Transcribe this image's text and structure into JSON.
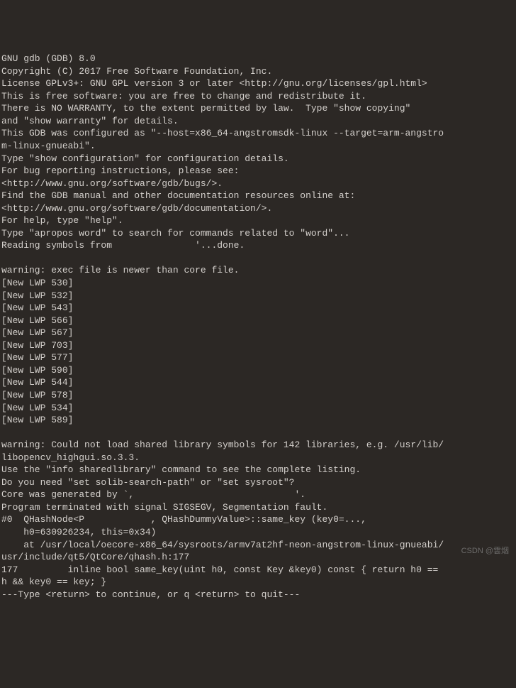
{
  "terminal": {
    "lines": [
      "GNU gdb (GDB) 8.0",
      "Copyright (C) 2017 Free Software Foundation, Inc.",
      "License GPLv3+: GNU GPL version 3 or later <http://gnu.org/licenses/gpl.html>",
      "This is free software: you are free to change and redistribute it.",
      "There is NO WARRANTY, to the extent permitted by law.  Type \"show copying\"",
      "and \"show warranty\" for details.",
      "This GDB was configured as \"--host=x86_64-angstromsdk-linux --target=arm-angstro",
      "m-linux-gnueabi\".",
      "Type \"show configuration\" for configuration details.",
      "For bug reporting instructions, please see:",
      "<http://www.gnu.org/software/gdb/bugs/>.",
      "Find the GDB manual and other documentation resources online at:",
      "<http://www.gnu.org/software/gdb/documentation/>.",
      "For help, type \"help\".",
      "Type \"apropos word\" to search for commands related to \"word\"...",
      "Reading symbols from               '...done.",
      "",
      "warning: exec file is newer than core file.",
      "[New LWP 530]",
      "[New LWP 532]",
      "[New LWP 543]",
      "[New LWP 566]",
      "[New LWP 567]",
      "[New LWP 703]",
      "[New LWP 577]",
      "[New LWP 590]",
      "[New LWP 544]",
      "[New LWP 578]",
      "[New LWP 534]",
      "[New LWP 589]",
      "",
      "warning: Could not load shared library symbols for 142 libraries, e.g. /usr/lib/",
      "libopencv_highgui.so.3.3.",
      "Use the \"info sharedlibrary\" command to see the complete listing.",
      "Do you need \"set solib-search-path\" or \"set sysroot\"?",
      "Core was generated by `,                             '.",
      "Program terminated with signal SIGSEGV, Segmentation fault.",
      "#0  QHashNode<P            , QHashDummyValue>::same_key (key0=...,",
      "    h0=630926234, this=0x34)",
      "    at /usr/local/oecore-x86_64/sysroots/armv7at2hf-neon-angstrom-linux-gnueabi/",
      "usr/include/qt5/QtCore/qhash.h:177",
      "177         inline bool same_key(uint h0, const Key &key0) const { return h0 ==",
      "h && key0 == key; }",
      "---Type <return> to continue, or q <return> to quit---"
    ]
  },
  "watermark": "CSDN @雲烟"
}
